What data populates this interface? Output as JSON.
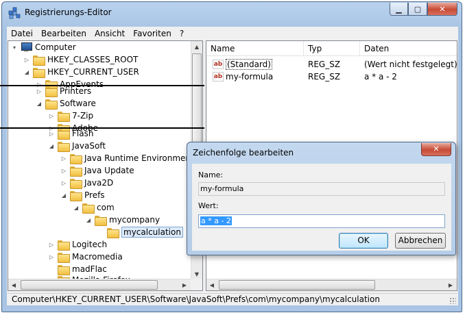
{
  "window": {
    "title": "Registrierungs-Editor"
  },
  "menu": [
    "Datei",
    "Bearbeiten",
    "Ansicht",
    "Favoriten",
    "?"
  ],
  "tree": [
    {
      "label": "Computer",
      "expander": "▾",
      "icon": "computer-icon"
    },
    {
      "label": "HKEY_CLASSES_ROOT",
      "expander": "▷",
      "icon": "folder-icon"
    },
    {
      "label": "HKEY_CURRENT_USER",
      "expander": "◢",
      "icon": "folder-icon"
    },
    {
      "label": "AppEvents",
      "expander": "▷",
      "icon": "folder-icon"
    },
    {
      "label": "Printers",
      "expander": "▷",
      "icon": "folder-icon"
    },
    {
      "label": "Software",
      "expander": "◢",
      "icon": "folder-icon"
    },
    {
      "label": "7-Zip",
      "expander": "▷",
      "icon": "folder-icon"
    },
    {
      "label": "Adobe",
      "expander": "▷",
      "icon": "folder-icon"
    },
    {
      "label": "Flash",
      "expander": "▷",
      "icon": "folder-icon"
    },
    {
      "label": "JavaSoft",
      "expander": "◢",
      "icon": "folder-icon"
    },
    {
      "label": "Java Runtime Environment",
      "expander": "▷",
      "icon": "folder-icon"
    },
    {
      "label": "Java Update",
      "expander": "▷",
      "icon": "folder-icon"
    },
    {
      "label": "Java2D",
      "expander": "▷",
      "icon": "folder-icon"
    },
    {
      "label": "Prefs",
      "expander": "◢",
      "icon": "folder-icon"
    },
    {
      "label": "com",
      "expander": "◢",
      "icon": "folder-icon"
    },
    {
      "label": "mycompany",
      "expander": "◢",
      "icon": "folder-icon"
    },
    {
      "label": "mycalculation",
      "expander": "",
      "icon": "folder-icon",
      "selected": true
    },
    {
      "label": "Logitech",
      "expander": "▷",
      "icon": "folder-icon"
    },
    {
      "label": "Macromedia",
      "expander": "▷",
      "icon": "folder-icon"
    },
    {
      "label": "madFlac",
      "expander": "",
      "icon": "folder-icon"
    },
    {
      "label": "Mozilla Firefox",
      "expander": "▷",
      "icon": "folder-icon"
    }
  ],
  "list": {
    "columns": [
      "Name",
      "Typ",
      "Daten"
    ],
    "rows": [
      {
        "name": "(Standard)",
        "type": "REG_SZ",
        "data": "(Wert nicht festgelegt)"
      },
      {
        "name": "my-formula",
        "type": "REG_SZ",
        "data": "a * a - 2"
      }
    ]
  },
  "status": "Computer\\HKEY_CURRENT_USER\\Software\\JavaSoft\\Prefs\\com\\mycompany\\mycalculation",
  "dialog": {
    "title": "Zeichenfolge bearbeiten",
    "name_label": "Name:",
    "name_value": "my-formula",
    "value_label": "Wert:",
    "value_value": "a * a - 2",
    "ok_label": "OK",
    "cancel_label": "Abbrechen",
    "close_glyph": "✕"
  },
  "icons": {
    "minimize": "▁",
    "maximize": "▢",
    "close": "✕",
    "scroll_up": "▲",
    "scroll_down": "▼",
    "scroll_left": "◀",
    "scroll_right": "▶"
  }
}
